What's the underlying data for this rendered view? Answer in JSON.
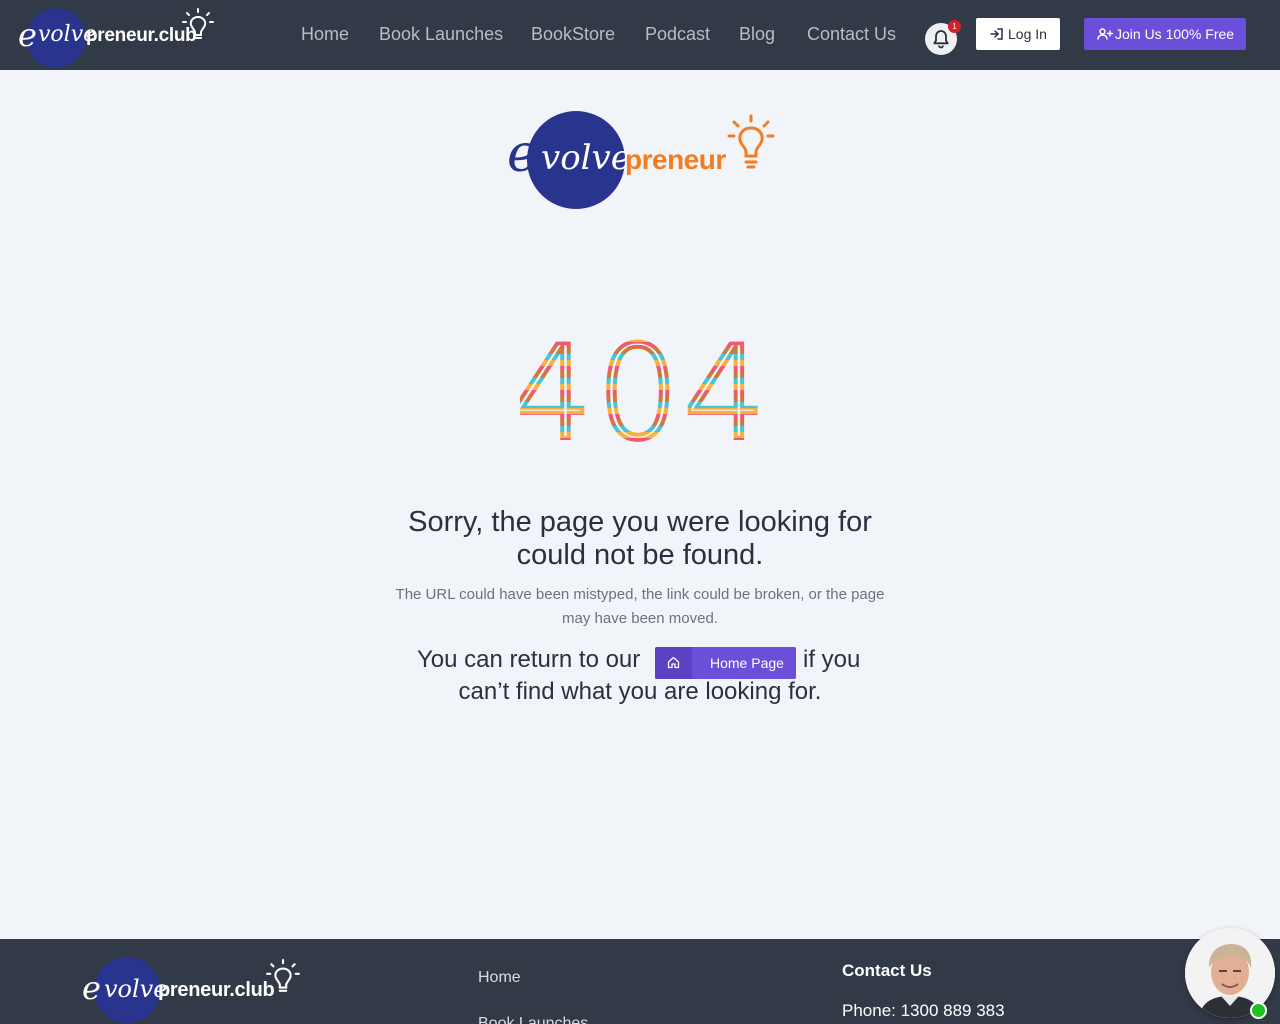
{
  "brand": {
    "logo_text_e": "e",
    "logo_text_volve": "volve",
    "logo_text_rest": "preneur.club"
  },
  "nav": {
    "items": [
      "Home",
      "Book Launches",
      "BookStore",
      "Podcast",
      "Blog",
      "Contact Us"
    ]
  },
  "notifications": {
    "count": "1",
    "icon": "bell-icon"
  },
  "auth": {
    "login_label": "Log In",
    "join_label": "Join Us 100% Free"
  },
  "hero_logo": {
    "e": "e",
    "volve": "volve",
    "rest": "preneur"
  },
  "error": {
    "code": "404",
    "headline": "Sorry, the page you were looking for could not be found.",
    "subtext": "The URL could have been mistyped, the link could be broken, or the page may have been moved.",
    "return_before": "You can return to our",
    "home_button_label": "Home Page",
    "return_after": "if you",
    "return_line2": "can’t find what you are looking for."
  },
  "footer": {
    "logo_e": "e",
    "logo_volve": "volve",
    "logo_rest": "preneur.club",
    "links": [
      "Home",
      "Book Launches"
    ],
    "contact_title": "Contact Us",
    "phone": "Phone: 1300 889 383"
  },
  "colors": {
    "header_bg": "#333a47",
    "page_bg": "#f1f4f8",
    "accent": "#6b4fd9",
    "brand_blue": "#28348e",
    "brand_orange": "#f57d1f",
    "badge_red": "#d71f2c",
    "online_green": "#1fc11f"
  }
}
